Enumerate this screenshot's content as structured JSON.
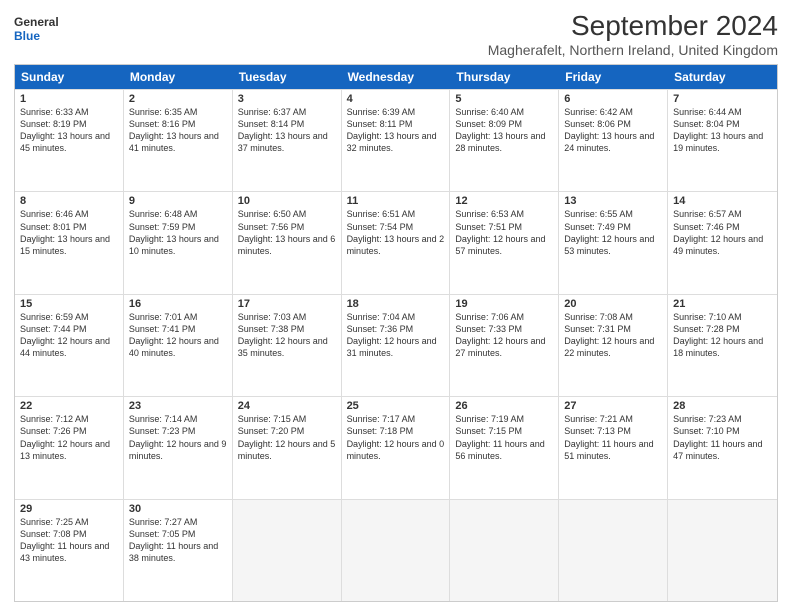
{
  "logo": {
    "line1": "General",
    "line2": "Blue"
  },
  "title": "September 2024",
  "subtitle": "Magherafelt, Northern Ireland, United Kingdom",
  "header_days": [
    "Sunday",
    "Monday",
    "Tuesday",
    "Wednesday",
    "Thursday",
    "Friday",
    "Saturday"
  ],
  "weeks": [
    [
      {
        "day": "1",
        "sunrise": "6:33 AM",
        "sunset": "8:19 PM",
        "daylight": "13 hours and 45 minutes."
      },
      {
        "day": "2",
        "sunrise": "6:35 AM",
        "sunset": "8:16 PM",
        "daylight": "13 hours and 41 minutes."
      },
      {
        "day": "3",
        "sunrise": "6:37 AM",
        "sunset": "8:14 PM",
        "daylight": "13 hours and 37 minutes."
      },
      {
        "day": "4",
        "sunrise": "6:39 AM",
        "sunset": "8:11 PM",
        "daylight": "13 hours and 32 minutes."
      },
      {
        "day": "5",
        "sunrise": "6:40 AM",
        "sunset": "8:09 PM",
        "daylight": "13 hours and 28 minutes."
      },
      {
        "day": "6",
        "sunrise": "6:42 AM",
        "sunset": "8:06 PM",
        "daylight": "13 hours and 24 minutes."
      },
      {
        "day": "7",
        "sunrise": "6:44 AM",
        "sunset": "8:04 PM",
        "daylight": "13 hours and 19 minutes."
      }
    ],
    [
      {
        "day": "8",
        "sunrise": "6:46 AM",
        "sunset": "8:01 PM",
        "daylight": "13 hours and 15 minutes."
      },
      {
        "day": "9",
        "sunrise": "6:48 AM",
        "sunset": "7:59 PM",
        "daylight": "13 hours and 10 minutes."
      },
      {
        "day": "10",
        "sunrise": "6:50 AM",
        "sunset": "7:56 PM",
        "daylight": "13 hours and 6 minutes."
      },
      {
        "day": "11",
        "sunrise": "6:51 AM",
        "sunset": "7:54 PM",
        "daylight": "13 hours and 2 minutes."
      },
      {
        "day": "12",
        "sunrise": "6:53 AM",
        "sunset": "7:51 PM",
        "daylight": "12 hours and 57 minutes."
      },
      {
        "day": "13",
        "sunrise": "6:55 AM",
        "sunset": "7:49 PM",
        "daylight": "12 hours and 53 minutes."
      },
      {
        "day": "14",
        "sunrise": "6:57 AM",
        "sunset": "7:46 PM",
        "daylight": "12 hours and 49 minutes."
      }
    ],
    [
      {
        "day": "15",
        "sunrise": "6:59 AM",
        "sunset": "7:44 PM",
        "daylight": "12 hours and 44 minutes."
      },
      {
        "day": "16",
        "sunrise": "7:01 AM",
        "sunset": "7:41 PM",
        "daylight": "12 hours and 40 minutes."
      },
      {
        "day": "17",
        "sunrise": "7:03 AM",
        "sunset": "7:38 PM",
        "daylight": "12 hours and 35 minutes."
      },
      {
        "day": "18",
        "sunrise": "7:04 AM",
        "sunset": "7:36 PM",
        "daylight": "12 hours and 31 minutes."
      },
      {
        "day": "19",
        "sunrise": "7:06 AM",
        "sunset": "7:33 PM",
        "daylight": "12 hours and 27 minutes."
      },
      {
        "day": "20",
        "sunrise": "7:08 AM",
        "sunset": "7:31 PM",
        "daylight": "12 hours and 22 minutes."
      },
      {
        "day": "21",
        "sunrise": "7:10 AM",
        "sunset": "7:28 PM",
        "daylight": "12 hours and 18 minutes."
      }
    ],
    [
      {
        "day": "22",
        "sunrise": "7:12 AM",
        "sunset": "7:26 PM",
        "daylight": "12 hours and 13 minutes."
      },
      {
        "day": "23",
        "sunrise": "7:14 AM",
        "sunset": "7:23 PM",
        "daylight": "12 hours and 9 minutes."
      },
      {
        "day": "24",
        "sunrise": "7:15 AM",
        "sunset": "7:20 PM",
        "daylight": "12 hours and 5 minutes."
      },
      {
        "day": "25",
        "sunrise": "7:17 AM",
        "sunset": "7:18 PM",
        "daylight": "12 hours and 0 minutes."
      },
      {
        "day": "26",
        "sunrise": "7:19 AM",
        "sunset": "7:15 PM",
        "daylight": "11 hours and 56 minutes."
      },
      {
        "day": "27",
        "sunrise": "7:21 AM",
        "sunset": "7:13 PM",
        "daylight": "11 hours and 51 minutes."
      },
      {
        "day": "28",
        "sunrise": "7:23 AM",
        "sunset": "7:10 PM",
        "daylight": "11 hours and 47 minutes."
      }
    ],
    [
      {
        "day": "29",
        "sunrise": "7:25 AM",
        "sunset": "7:08 PM",
        "daylight": "11 hours and 43 minutes."
      },
      {
        "day": "30",
        "sunrise": "7:27 AM",
        "sunset": "7:05 PM",
        "daylight": "11 hours and 38 minutes."
      },
      {
        "day": "",
        "sunrise": "",
        "sunset": "",
        "daylight": ""
      },
      {
        "day": "",
        "sunrise": "",
        "sunset": "",
        "daylight": ""
      },
      {
        "day": "",
        "sunrise": "",
        "sunset": "",
        "daylight": ""
      },
      {
        "day": "",
        "sunrise": "",
        "sunset": "",
        "daylight": ""
      },
      {
        "day": "",
        "sunrise": "",
        "sunset": "",
        "daylight": ""
      }
    ]
  ]
}
